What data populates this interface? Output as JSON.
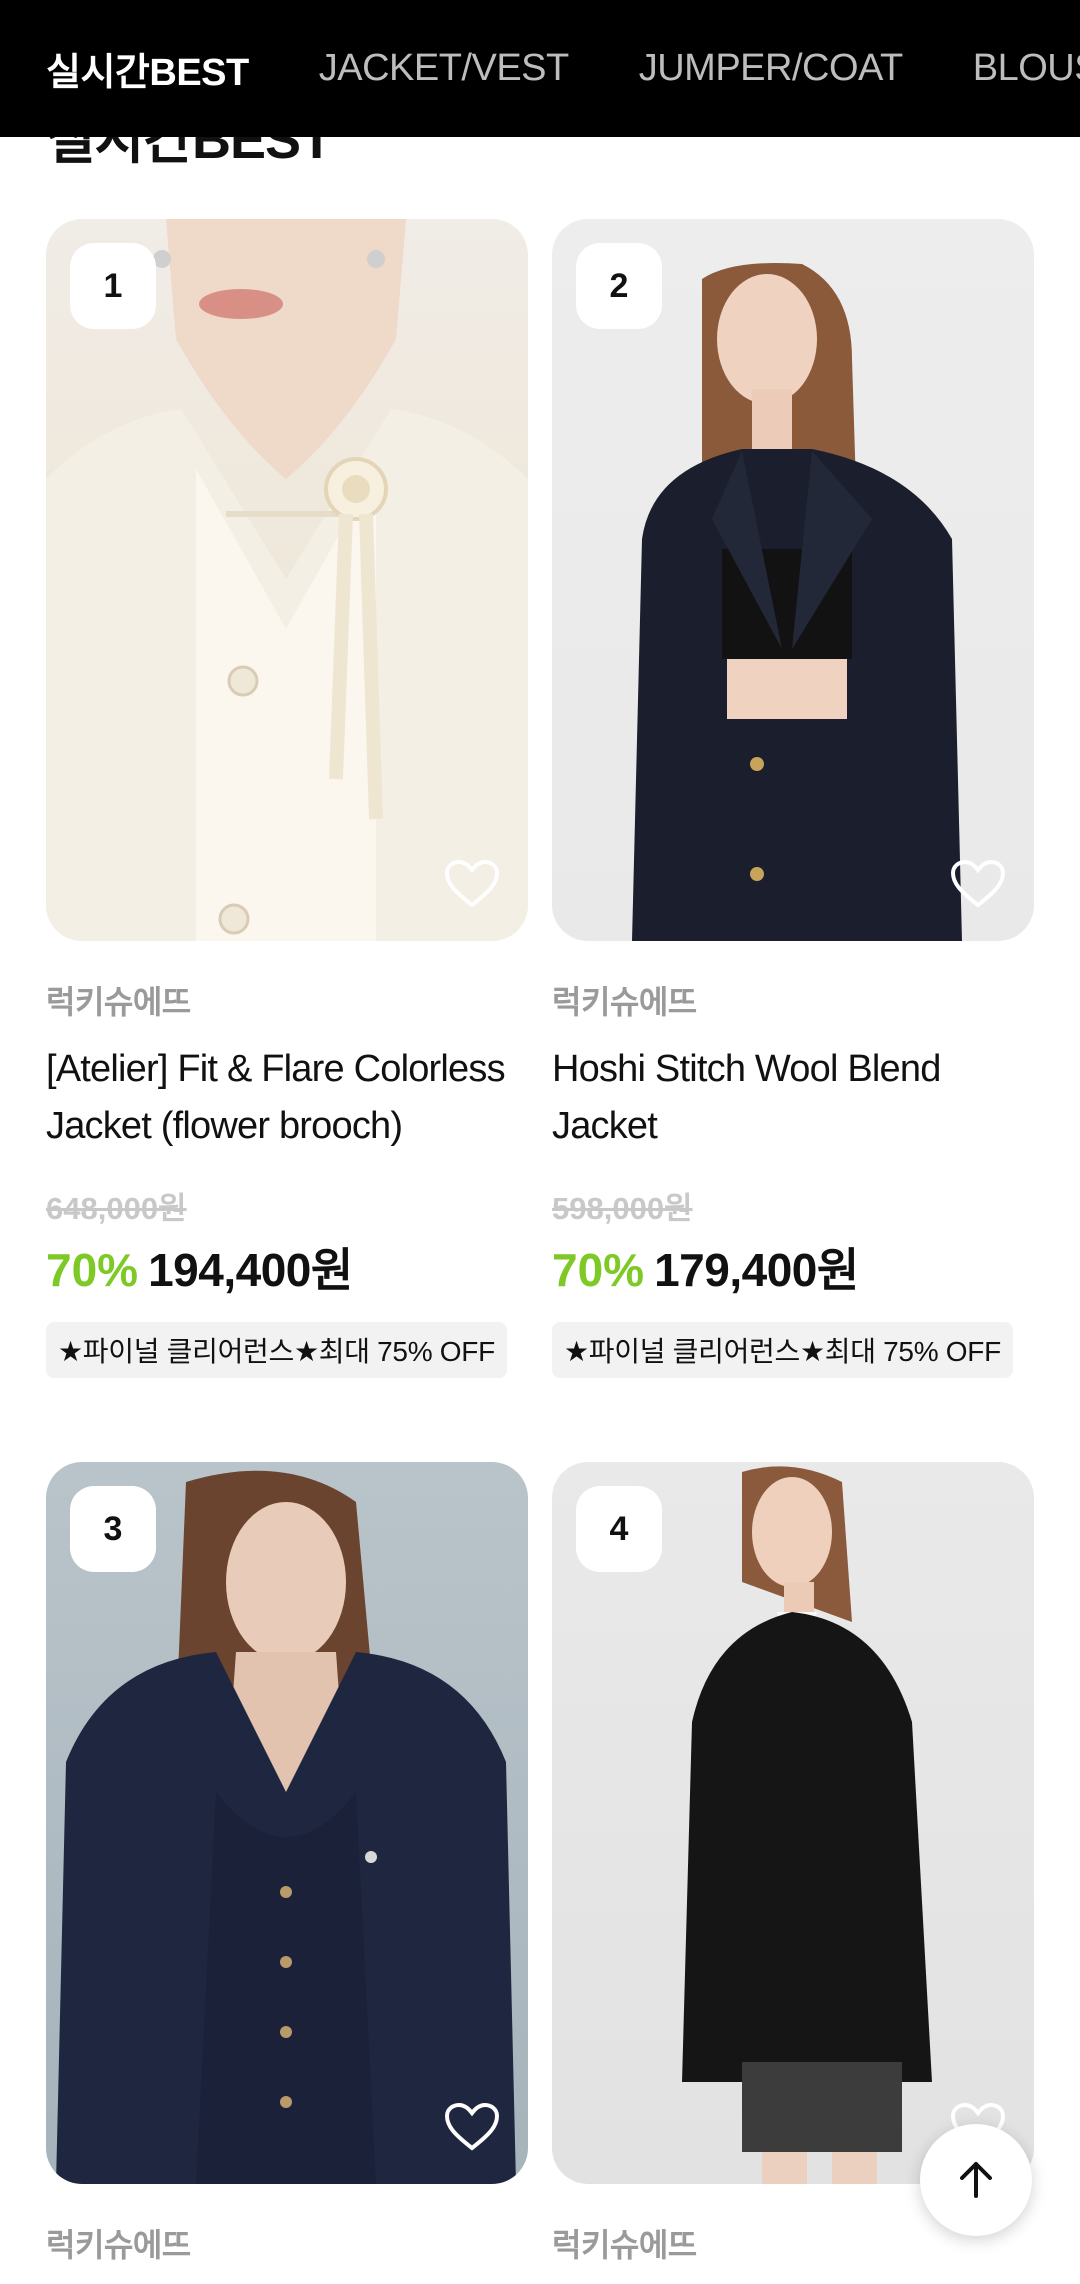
{
  "nav": {
    "tabs": [
      "실시간BEST",
      "JACKET/VEST",
      "JUMPER/COAT",
      "BLOUS"
    ]
  },
  "section": {
    "title": "실시간BEST"
  },
  "products": [
    {
      "rank": "1",
      "brand": "럭키슈에뜨",
      "name": "[Atelier] Fit & Flare Colorless Jacket (flower brooch)",
      "original_price": "648,000원",
      "discount": "70%",
      "price": "194,400원",
      "promo": "★파이널 클리어런스★최대 75% OFF"
    },
    {
      "rank": "2",
      "brand": "럭키슈에뜨",
      "name": "Hoshi Stitch Wool Blend Jacket",
      "original_price": "598,000원",
      "discount": "70%",
      "price": "179,400원",
      "promo": "★파이널 클리어런스★최대 75% OFF"
    },
    {
      "rank": "3",
      "brand": "럭키슈에뜨"
    },
    {
      "rank": "4",
      "brand": "럭키슈에뜨"
    }
  ],
  "colors": {
    "discount": "#7ec926",
    "topbar": "#000000"
  },
  "icons": {
    "heart": "heart-icon",
    "scroll_top": "arrow-up-icon"
  }
}
